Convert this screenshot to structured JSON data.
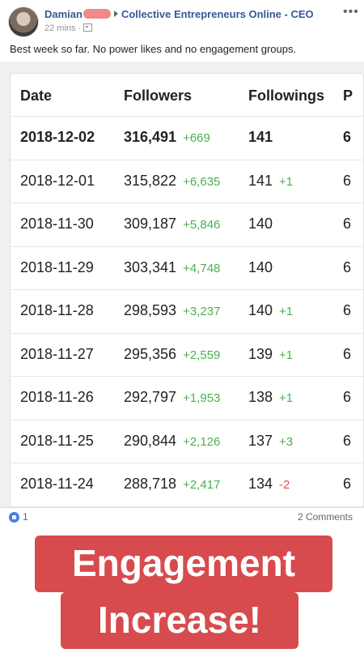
{
  "post": {
    "author": "Damian",
    "group": "Collective Entrepreneurs Online - CEO",
    "time": "22 mins ·",
    "text": "Best week so far. No power likes and no engagement groups.",
    "more": "•••",
    "reactions_count": "1",
    "comments": "2 Comments"
  },
  "table": {
    "headers": {
      "date": "Date",
      "followers": "Followers",
      "followings": "Followings",
      "p": "P"
    },
    "rows": [
      {
        "date": "2018-12-02",
        "followers": "316,491",
        "followers_delta": "+669",
        "followings": "141",
        "followings_delta": "",
        "p": "6"
      },
      {
        "date": "2018-12-01",
        "followers": "315,822",
        "followers_delta": "+6,635",
        "followings": "141",
        "followings_delta": "+1",
        "p": "6"
      },
      {
        "date": "2018-11-30",
        "followers": "309,187",
        "followers_delta": "+5,846",
        "followings": "140",
        "followings_delta": "",
        "p": "6"
      },
      {
        "date": "2018-11-29",
        "followers": "303,341",
        "followers_delta": "+4,748",
        "followings": "140",
        "followings_delta": "",
        "p": "6"
      },
      {
        "date": "2018-11-28",
        "followers": "298,593",
        "followers_delta": "+3,237",
        "followings": "140",
        "followings_delta": "+1",
        "p": "6"
      },
      {
        "date": "2018-11-27",
        "followers": "295,356",
        "followers_delta": "+2,559",
        "followings": "139",
        "followings_delta": "+1",
        "p": "6"
      },
      {
        "date": "2018-11-26",
        "followers": "292,797",
        "followers_delta": "+1,953",
        "followings": "138",
        "followings_delta": "+1",
        "p": "6"
      },
      {
        "date": "2018-11-25",
        "followers": "290,844",
        "followers_delta": "+2,126",
        "followings": "137",
        "followings_delta": "+3",
        "p": "6"
      },
      {
        "date": "2018-11-24",
        "followers": "288,718",
        "followers_delta": "+2,417",
        "followings": "134",
        "followings_delta": "-2",
        "p": "6"
      }
    ]
  },
  "banner": {
    "line1": "Engagement",
    "line2": "Increase!"
  },
  "colors": {
    "positive": "#4caf50",
    "negative": "#e05050",
    "banner": "#d74b4e",
    "link": "#385898"
  }
}
